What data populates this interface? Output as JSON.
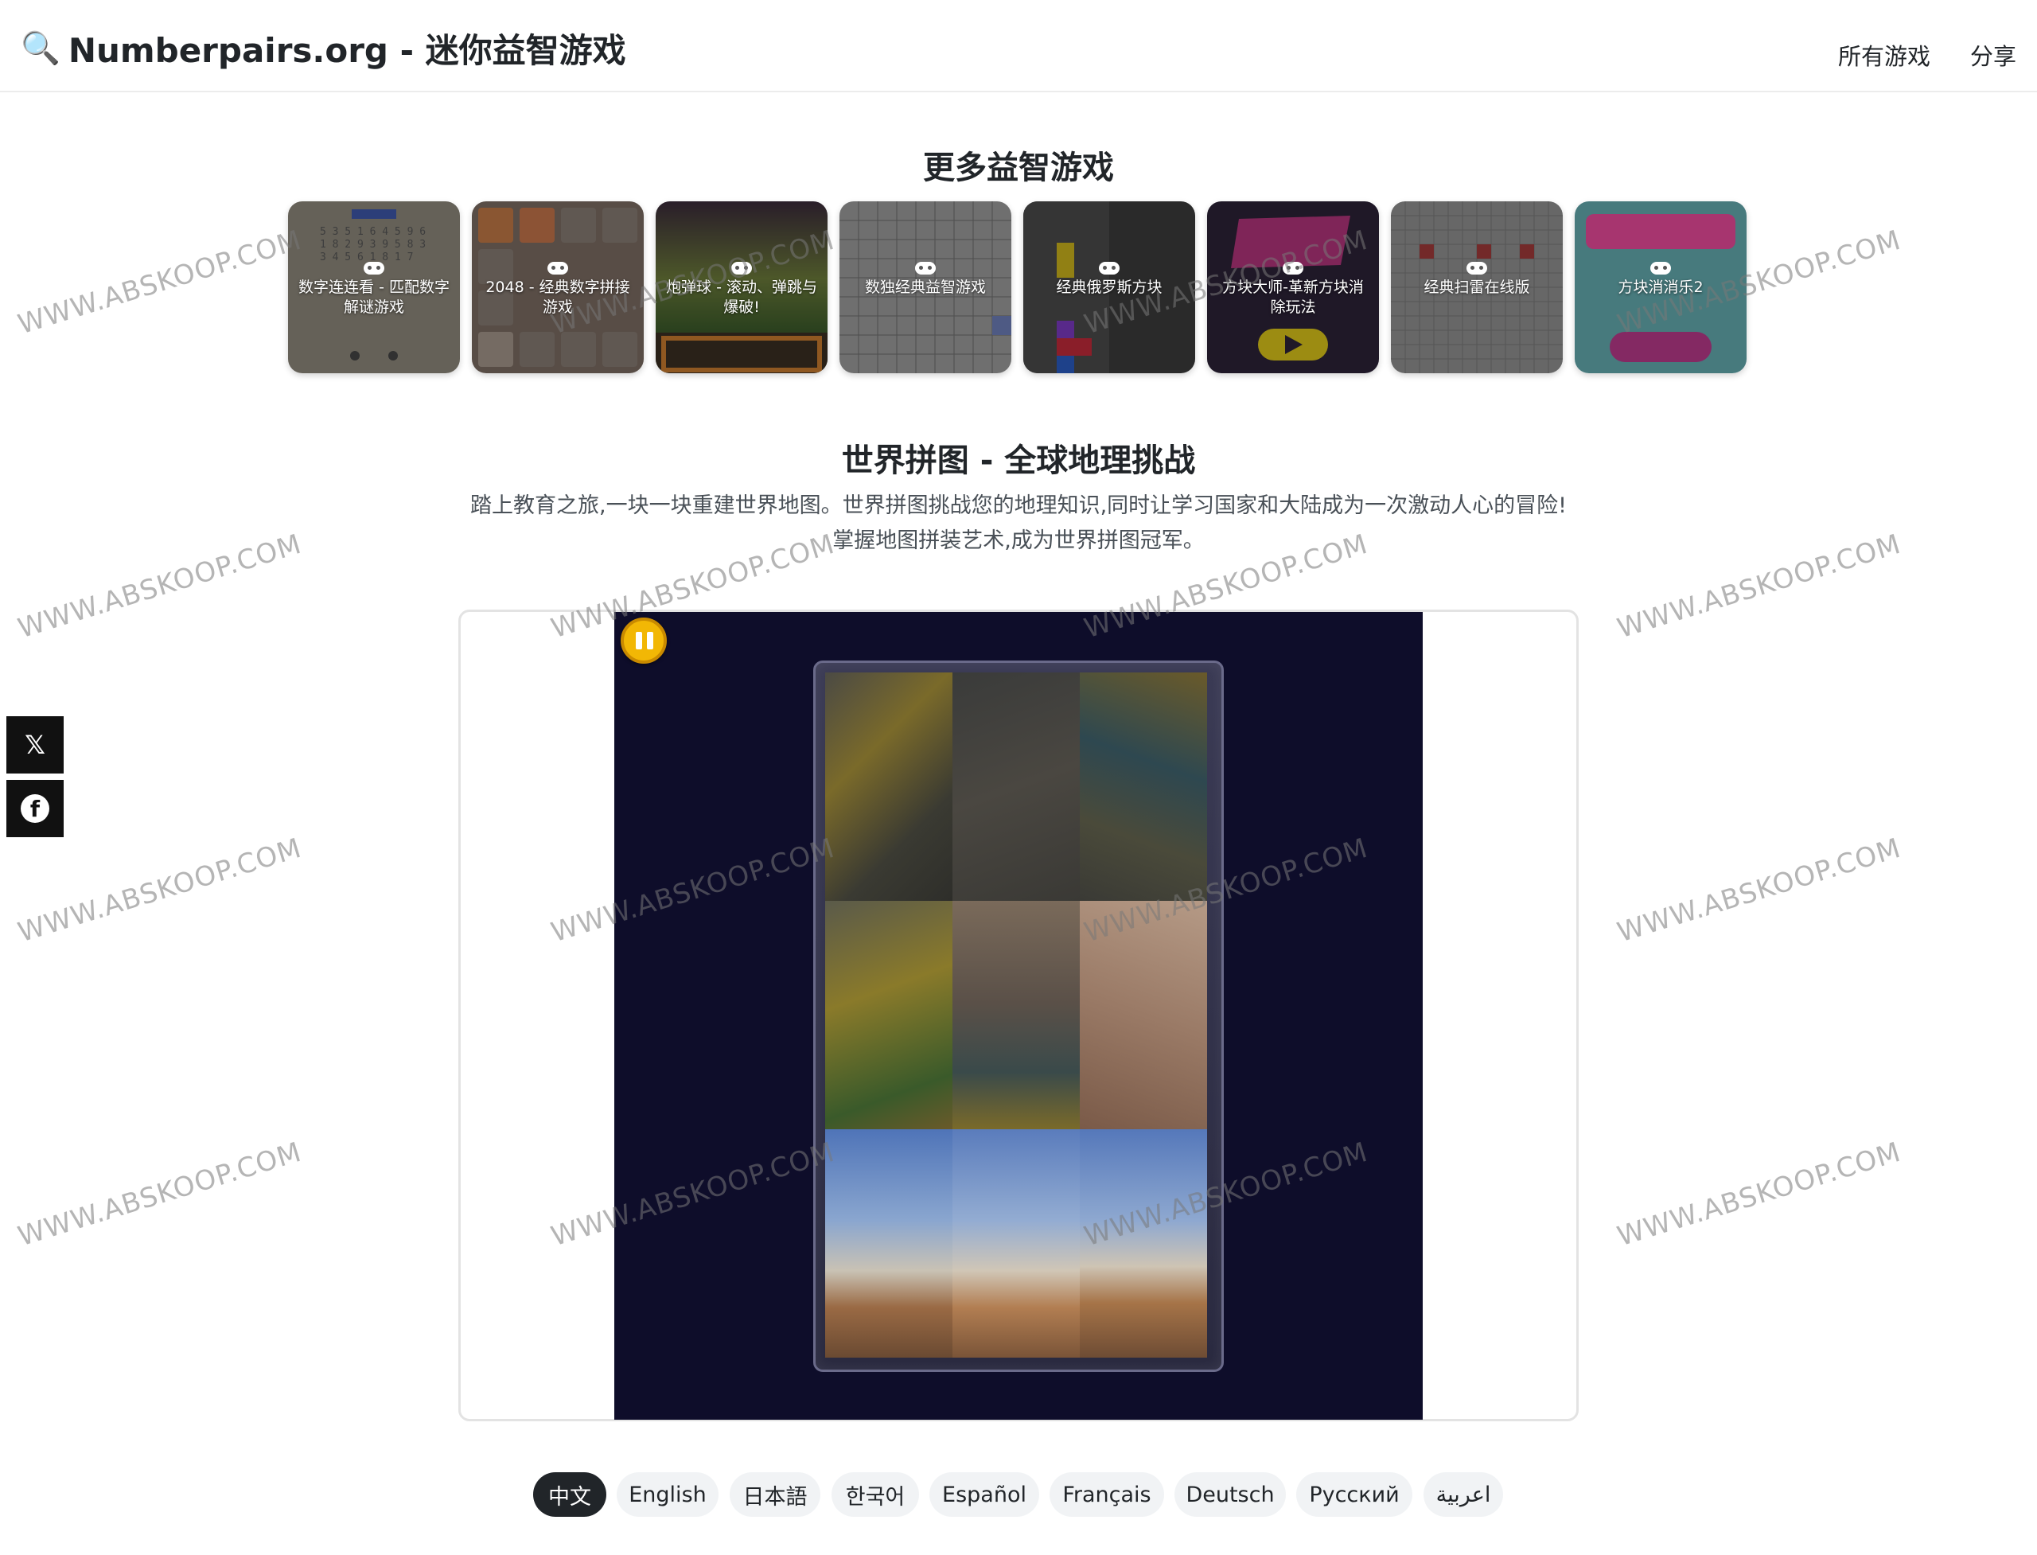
{
  "header": {
    "logo_icon": "magnifier-icon",
    "title": "Numberpairs.org - 迷你益智游戏",
    "nav": [
      "所有游戏",
      "分享"
    ]
  },
  "more_games": {
    "title": "更多益智游戏",
    "cards": [
      {
        "label": "数字连连看 - 匹配数字解谜游戏",
        "thumb_color": "#8a8478"
      },
      {
        "label": "2048 - 经典数字拼接游戏",
        "thumb_color": "#7a6e66"
      },
      {
        "label": "炮弹球 - 滚动、弹跳与爆破!",
        "thumb_color": "#4b5a2c"
      },
      {
        "label": "数独经典益智游戏",
        "thumb_color": "#8d8d8d"
      },
      {
        "label": "经典俄罗斯方块",
        "thumb_color": "#3a3a3a"
      },
      {
        "label": "方块大师-革新方块消除玩法",
        "thumb_color": "#2a2235"
      },
      {
        "label": "经典扫雷在线版",
        "thumb_color": "#8a8a8a"
      },
      {
        "label": "方块消消乐2",
        "thumb_color": "#62a7ad"
      }
    ]
  },
  "main": {
    "title": "世界拼图 - 全球地理挑战",
    "description_line1": "踏上教育之旅,一块一块重建世界地图。世界拼图挑战您的地理知识,同时让学习国家和大陆成为一次激动人心的冒险!",
    "description_line2": "掌握地图拼装艺术,成为世界拼图冠军。"
  },
  "game": {
    "pause_icon": "pause-icon",
    "board_background": "#0e0d2a"
  },
  "social": [
    {
      "icon": "x-icon",
      "glyph": "𝕏"
    },
    {
      "icon": "facebook-icon",
      "glyph": "f"
    }
  ],
  "languages": {
    "items": [
      "中文",
      "English",
      "日本語",
      "한국어",
      "Español",
      "Français",
      "Deutsch",
      "Русский",
      "اعربية"
    ],
    "active": "中文"
  },
  "watermark": "WWW.ABSKOOP.COM"
}
